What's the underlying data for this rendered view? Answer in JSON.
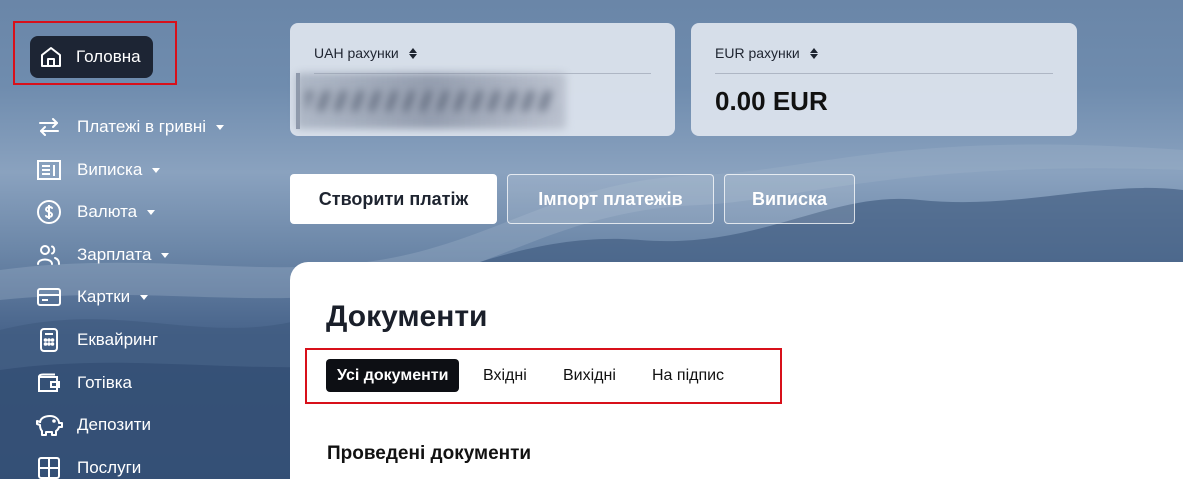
{
  "sidebar": {
    "home_label": "Головна",
    "items": [
      {
        "label": "Платежі в гривні",
        "icon": "transfer-arrows-icon",
        "dropdown": true
      },
      {
        "label": "Виписка",
        "icon": "statement-icon",
        "dropdown": true
      },
      {
        "label": "Валюта",
        "icon": "dollar-coin-icon",
        "dropdown": true
      },
      {
        "label": "Зарплата",
        "icon": "people-icon",
        "dropdown": true
      },
      {
        "label": "Картки",
        "icon": "card-icon",
        "dropdown": true
      },
      {
        "label": "Еквайринг",
        "icon": "pos-terminal-icon",
        "dropdown": false
      },
      {
        "label": "Готівка",
        "icon": "wallet-icon",
        "dropdown": false
      },
      {
        "label": "Депозити",
        "icon": "piggy-bank-icon",
        "dropdown": false
      },
      {
        "label": "Послуги",
        "icon": "services-grid-icon",
        "dropdown": false
      }
    ]
  },
  "accounts": {
    "uah_label": "UAH рахунки",
    "eur_label": "EUR рахунки",
    "eur_amount": "0.00 EUR"
  },
  "actions": {
    "create_payment": "Створити платіж",
    "import_payments": "Імпорт платежів",
    "statement": "Виписка"
  },
  "documents": {
    "title": "Документи",
    "tabs": [
      "Усі документи",
      "Вхідні",
      "Вихідні",
      "На підпис"
    ],
    "active_tab": "Усі документи",
    "section_title": "Проведені документи"
  },
  "colors": {
    "highlight": "#d8101a",
    "home_bg": "#1d2534",
    "active_tab_bg": "#0d0f14"
  }
}
